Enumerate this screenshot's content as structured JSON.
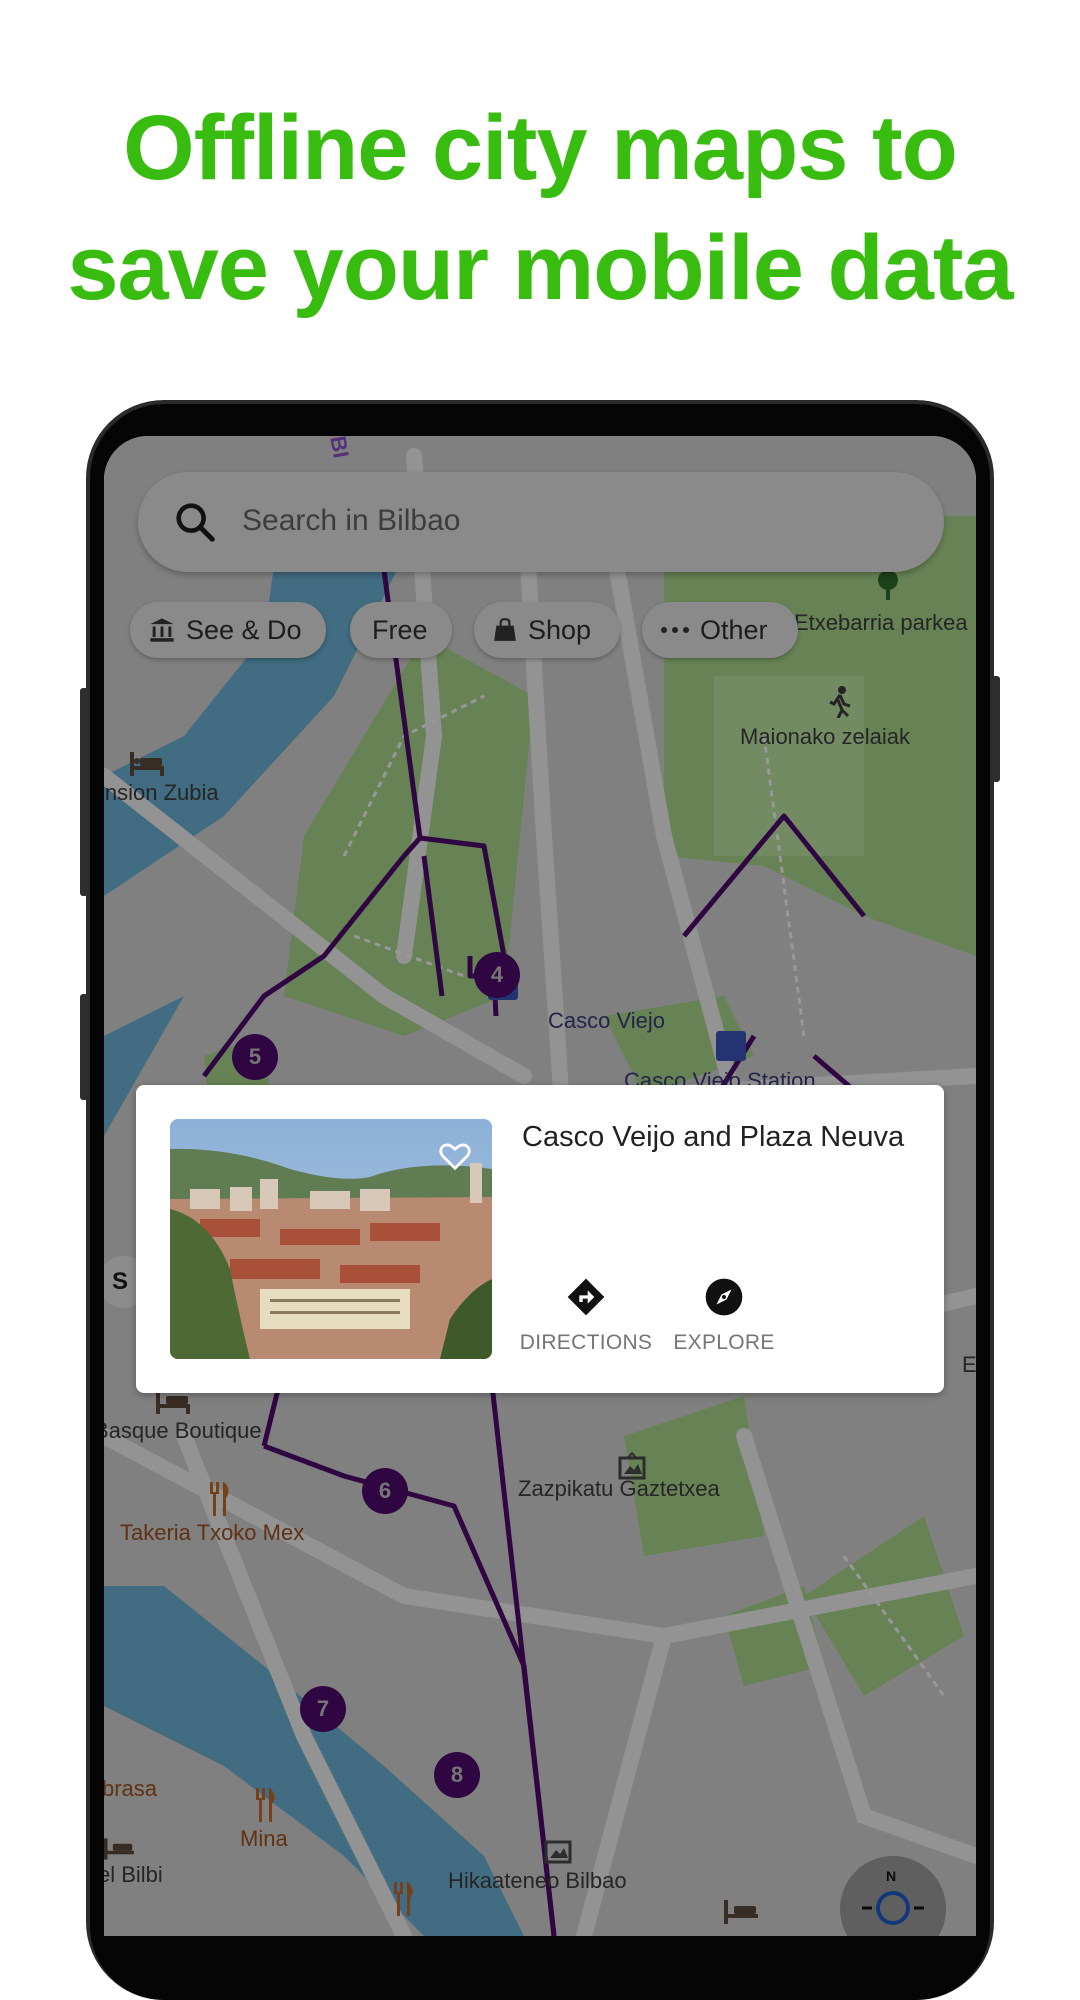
{
  "headline": {
    "line1": "Offline city maps to",
    "line2": "save your mobile data",
    "color": "#38bc10"
  },
  "search": {
    "placeholder": "Search in Bilbao",
    "icon": "search-icon"
  },
  "chips": [
    {
      "label": "See & Do",
      "icon": "museum-icon"
    },
    {
      "label": "Free",
      "icon": null
    },
    {
      "label": "Shop",
      "icon": "shopping-bag-icon"
    },
    {
      "label": "Other",
      "icon": "more-horizontal-icon"
    }
  ],
  "map": {
    "labels": {
      "etxebarria": "Etxebarria parkea",
      "maionako": "Maionako zelaiak",
      "pension": "Pension Zubia",
      "casco_viejo": "Casco Viejo",
      "casco_viejo_station": "Casco Viejo Station",
      "basque_boutique": "Basque Boutique",
      "takeria": "Takeria Txoko Mex",
      "zazpikatu": "Zazpikatu Gaztetxea",
      "brasa": "brasa",
      "mina": "Mina",
      "bilbi": "el Bilbi",
      "hikaateneo": "Hikaateneo Bilbao",
      "edge_e": "E",
      "edge_s": "S",
      "top_marker": "BI"
    },
    "stops": [
      "4",
      "5",
      "6",
      "7",
      "8"
    ],
    "route_color": "#4c0a6b",
    "compass_label": "N"
  },
  "place_card": {
    "title": "Casco Veijo and Plaza Neuva",
    "favorite_icon": "heart-outline-icon",
    "actions": [
      {
        "label": "DIRECTIONS",
        "icon": "directions-icon"
      },
      {
        "label": "EXPLORE",
        "icon": "compass-icon"
      }
    ]
  }
}
